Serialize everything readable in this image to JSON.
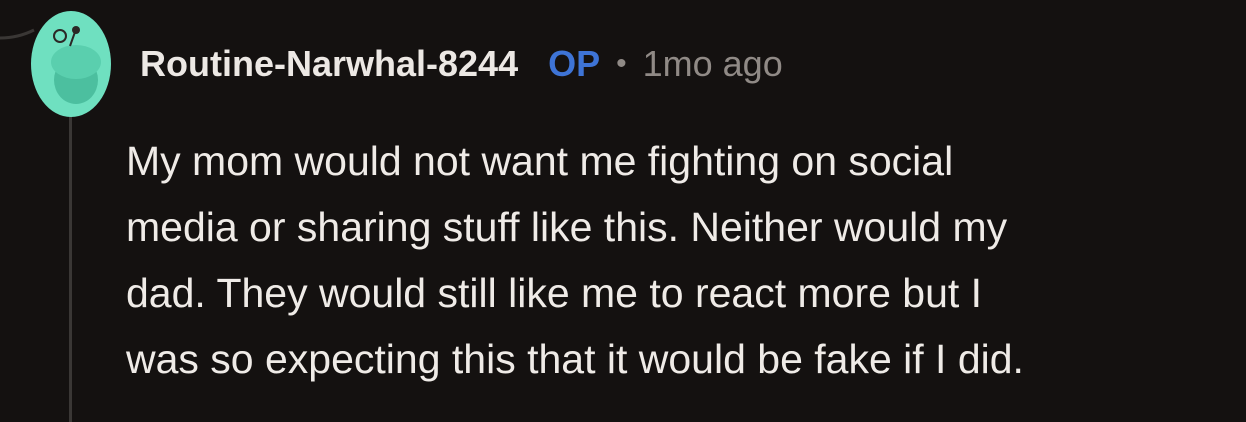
{
  "comment": {
    "author": "Routine-Narwhal-8244",
    "op_badge": "OP",
    "separator": "•",
    "timestamp": "1mo ago",
    "body_lines": [
      "My mom would not want me fighting on social",
      "media or sharing stuff like this. Neither would my",
      "dad. They would still like me to react more but I",
      "was so expecting this that it would be fake if I did."
    ]
  },
  "avatar": {
    "icon": "snoo-avatar-icon",
    "color": "#6fe0c0"
  },
  "colors": {
    "background": "#141110",
    "text": "#efebe7",
    "op_accent": "#3e74d6",
    "muted": "#908a86"
  }
}
